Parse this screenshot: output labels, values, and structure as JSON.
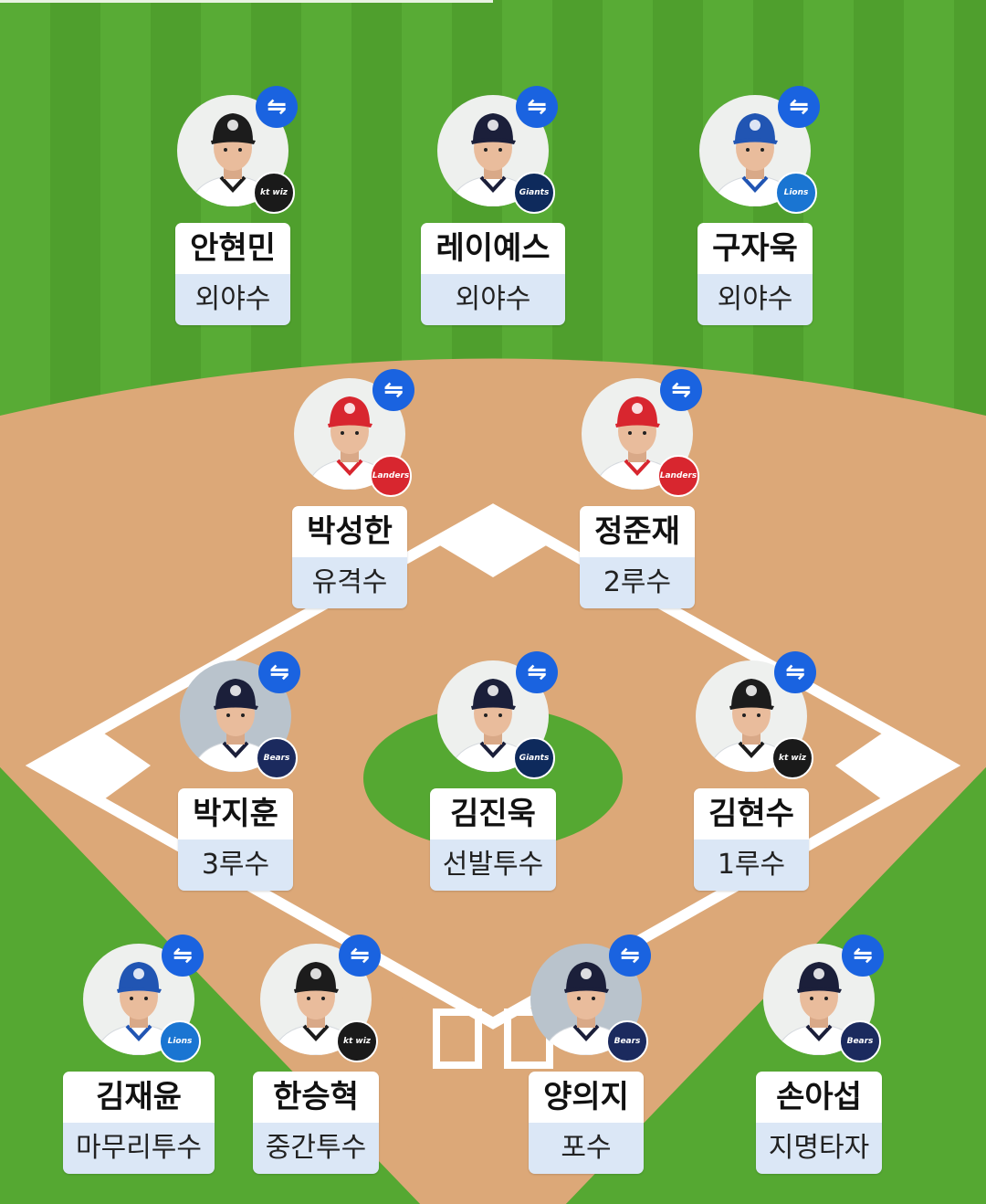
{
  "colors": {
    "grass": "#55a832",
    "grass_stripe": "#4e9f2c",
    "dirt": "#dca878",
    "swap_button": "#1a63e0",
    "position_bg": "#dbe7f6"
  },
  "players": [
    {
      "key": "lf",
      "name": "안현민",
      "position": "외야수",
      "team": "kt wiz",
      "team_color": "#1a1a1a",
      "cap_color": "#1c1c1c",
      "photo_bg": "light"
    },
    {
      "key": "cf",
      "name": "레이예스",
      "position": "외야수",
      "team": "Giants",
      "team_color": "#0e2a5c",
      "cap_color": "#1b1f3a",
      "photo_bg": "light"
    },
    {
      "key": "rf",
      "name": "구자욱",
      "position": "외야수",
      "team": "Lions",
      "team_color": "#1a75d2",
      "cap_color": "#2155b3",
      "photo_bg": "light"
    },
    {
      "key": "ss",
      "name": "박성한",
      "position": "유격수",
      "team": "Landers",
      "team_color": "#d8262f",
      "cap_color": "#d8262f",
      "photo_bg": "light"
    },
    {
      "key": "2b",
      "name": "정준재",
      "position": "2루수",
      "team": "Landers",
      "team_color": "#d8262f",
      "cap_color": "#d8262f",
      "photo_bg": "light"
    },
    {
      "key": "3b",
      "name": "박지훈",
      "position": "3루수",
      "team": "Bears",
      "team_color": "#1b2a5e",
      "cap_color": "#1b1f3a",
      "photo_bg": "dark"
    },
    {
      "key": "sp",
      "name": "김진욱",
      "position": "선발투수",
      "team": "Giants",
      "team_color": "#0e2a5c",
      "cap_color": "#1b1f3a",
      "photo_bg": "light"
    },
    {
      "key": "1b",
      "name": "김현수",
      "position": "1루수",
      "team": "kt wiz",
      "team_color": "#1a1a1a",
      "cap_color": "#1c1c1c",
      "photo_bg": "light"
    },
    {
      "key": "cl",
      "name": "김재윤",
      "position": "마무리투수",
      "team": "Lions",
      "team_color": "#1a75d2",
      "cap_color": "#2155b3",
      "photo_bg": "light"
    },
    {
      "key": "rp",
      "name": "한승혁",
      "position": "중간투수",
      "team": "kt wiz",
      "team_color": "#1a1a1a",
      "cap_color": "#1c1c1c",
      "photo_bg": "light"
    },
    {
      "key": "c",
      "name": "양의지",
      "position": "포수",
      "team": "Bears",
      "team_color": "#1b2a5e",
      "cap_color": "#1b1f3a",
      "photo_bg": "dark"
    },
    {
      "key": "dh",
      "name": "손아섭",
      "position": "지명타자",
      "team": "Bears",
      "team_color": "#1b2a5e",
      "cap_color": "#1b1f3a",
      "photo_bg": "light"
    }
  ],
  "swap_icon": "swap-arrows-icon",
  "swap_glyph": "⇋"
}
